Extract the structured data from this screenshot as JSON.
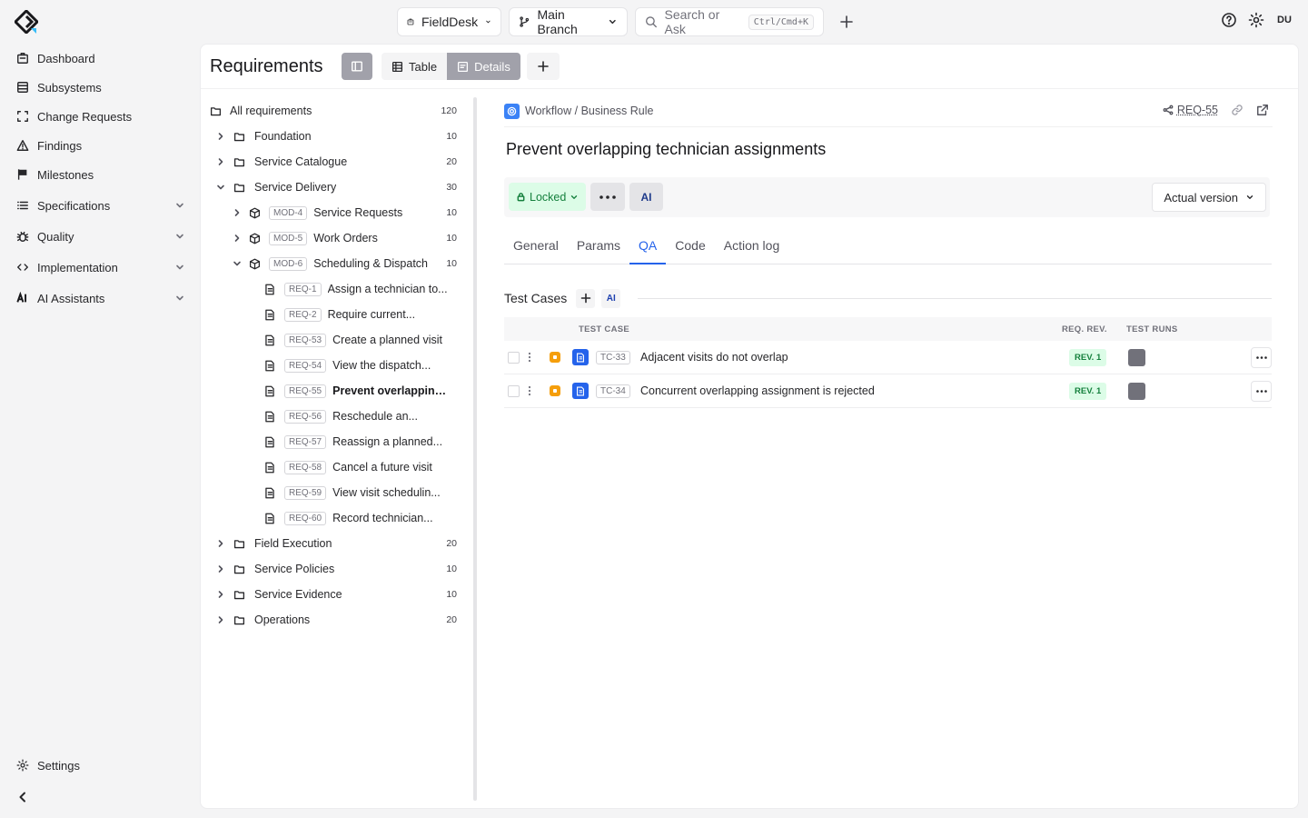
{
  "top": {
    "workspace": "FieldDesk",
    "branch": "Main Branch",
    "search_placeholder": "Search or Ask",
    "search_shortcut": "Ctrl/Cmd+K",
    "user_initials": "DU"
  },
  "sidebar": {
    "items": [
      {
        "label": "Dashboard",
        "icon": "building-icon"
      },
      {
        "label": "Subsystems",
        "icon": "server-icon"
      },
      {
        "label": "Change Requests",
        "icon": "scan-icon"
      },
      {
        "label": "Findings",
        "icon": "warning-icon"
      },
      {
        "label": "Milestones",
        "icon": "flag-icon"
      },
      {
        "label": "Specifications",
        "icon": "list-icon"
      },
      {
        "label": "Quality",
        "icon": "bug-icon"
      },
      {
        "label": "Implementation",
        "icon": "code-icon"
      },
      {
        "label": "AI Assistants",
        "icon": "ai-icon"
      }
    ],
    "settings_label": "Settings"
  },
  "header": {
    "title": "Requirements",
    "view_table": "Table",
    "view_details": "Details"
  },
  "tree": {
    "root": {
      "label": "All requirements",
      "count": "120"
    },
    "folders_top": [
      {
        "label": "Foundation",
        "count": "10"
      },
      {
        "label": "Service Catalogue",
        "count": "20"
      },
      {
        "label": "Service Delivery",
        "count": "30"
      }
    ],
    "modules": [
      {
        "id": "MOD-4",
        "label": "Service Requests",
        "count": "10"
      },
      {
        "id": "MOD-5",
        "label": "Work Orders",
        "count": "10"
      },
      {
        "id": "MOD-6",
        "label": "Scheduling & Dispatch",
        "count": "10"
      }
    ],
    "requirements": [
      {
        "id": "REQ-1",
        "label": "Assign a technician to..."
      },
      {
        "id": "REQ-2",
        "label": "Require current..."
      },
      {
        "id": "REQ-53",
        "label": "Create a planned visit"
      },
      {
        "id": "REQ-54",
        "label": "View the dispatch..."
      },
      {
        "id": "REQ-55",
        "label": "Prevent overlapping..."
      },
      {
        "id": "REQ-56",
        "label": "Reschedule an..."
      },
      {
        "id": "REQ-57",
        "label": "Reassign a planned..."
      },
      {
        "id": "REQ-58",
        "label": "Cancel a future visit"
      },
      {
        "id": "REQ-59",
        "label": "View visit schedulin..."
      },
      {
        "id": "REQ-60",
        "label": "Record technician..."
      }
    ],
    "folders_bottom": [
      {
        "label": "Field Execution",
        "count": "20"
      },
      {
        "label": "Service Policies",
        "count": "10"
      },
      {
        "label": "Service Evidence",
        "count": "10"
      },
      {
        "label": "Operations",
        "count": "20"
      }
    ]
  },
  "detail": {
    "breadcrumb": "Workflow / Business Rule",
    "req_id": "REQ-55",
    "title": "Prevent overlapping technician assignments",
    "status": "Locked",
    "ai_label": "AI",
    "version": "Actual version",
    "tabs": [
      "General",
      "Params",
      "QA",
      "Code",
      "Action log"
    ],
    "active_tab": "QA",
    "test_cases_title": "Test Cases",
    "columns": {
      "test_case": "TEST CASE",
      "req_rev": "REQ. REV.",
      "test_runs": "TEST RUNS"
    },
    "test_cases": [
      {
        "id": "TC-33",
        "name": "Adjacent visits do not overlap",
        "rev": "REV. 1"
      },
      {
        "id": "TC-34",
        "name": "Concurrent overlapping assignment is rejected",
        "rev": "REV. 1"
      }
    ]
  },
  "colors": {
    "accent": "#2563eb",
    "locked_bg": "#dcfce7",
    "locked_fg": "#15803d",
    "priority": "#f59e0b"
  }
}
